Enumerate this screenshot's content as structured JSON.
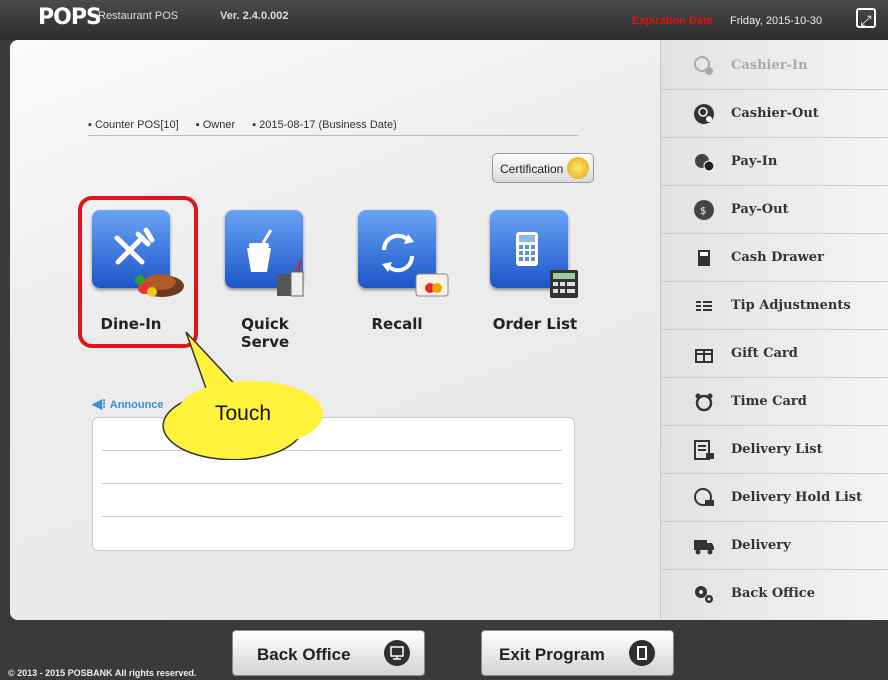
{
  "header": {
    "logo": "POPS",
    "logo_sub": "Restaurant POS",
    "version": "Ver. 2.4.0.002",
    "expiry_label": "Expiration Date",
    "expiry_date": "Friday, 2015-10-30"
  },
  "info": {
    "pos": "▪ Counter POS[10]",
    "user": "▪ Owner",
    "business_date": "▪ 2015-08-17 (Business Date)"
  },
  "certification_label": "Certification",
  "tiles": [
    {
      "label": "Dine-In",
      "icon": "fork-knife-icon"
    },
    {
      "label": "Quick Serve",
      "icon": "drink-cup-icon"
    },
    {
      "label": "Recall",
      "icon": "refresh-icon"
    },
    {
      "label": "Order List",
      "icon": "calculator-icon"
    }
  ],
  "callout": {
    "label": "Touch"
  },
  "announcement": {
    "title": "Announce"
  },
  "sidebar": {
    "items": [
      {
        "label": "Cashier-In",
        "icon": "user-in-icon",
        "disabled": true
      },
      {
        "label": "Cashier-Out",
        "icon": "user-out-icon"
      },
      {
        "label": "Pay-In",
        "icon": "coins-in-icon"
      },
      {
        "label": "Pay-Out",
        "icon": "coins-out-icon"
      },
      {
        "label": "Cash Drawer",
        "icon": "cash-drawer-icon"
      },
      {
        "label": "Tip Adjustments",
        "icon": "list-icon"
      },
      {
        "label": "Gift Card",
        "icon": "gift-icon"
      },
      {
        "label": "Time Card",
        "icon": "alarm-clock-icon"
      },
      {
        "label": "Delivery List",
        "icon": "delivery-list-icon"
      },
      {
        "label": "Delivery Hold List",
        "icon": "delivery-hold-icon"
      },
      {
        "label": "Delivery",
        "icon": "truck-icon"
      },
      {
        "label": "Back Office",
        "icon": "gears-icon"
      }
    ]
  },
  "footer": {
    "back_office": "Back Office",
    "exit_program": "Exit Program",
    "copyright": "© 2013 - 2015 POSBANK All rights reserved."
  },
  "colors": {
    "accent_blue": "#2a6de0",
    "highlight_red": "#e0151b",
    "callout_yellow": "#fff23a"
  }
}
